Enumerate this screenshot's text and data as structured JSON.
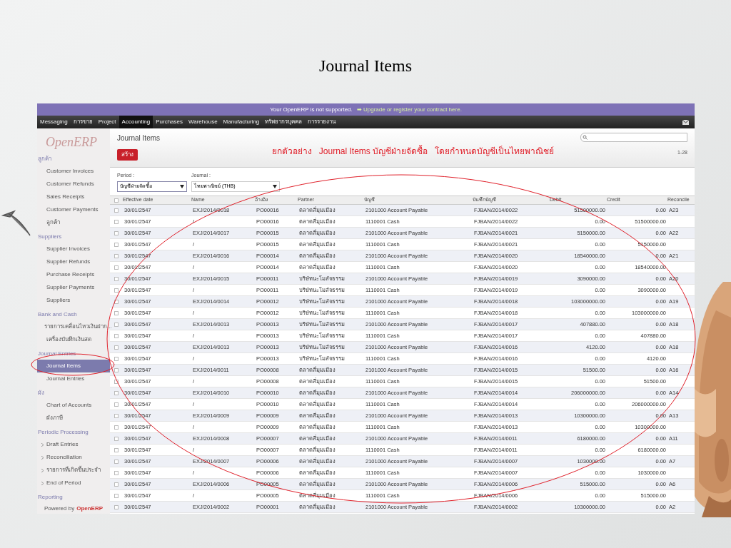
{
  "slide_title": "Journal Items",
  "banner": {
    "text": "Your OpenERP is not supported.",
    "link": "➡ Upgrade or register your contract here."
  },
  "top_menu": [
    {
      "label": "Messaging",
      "selected": false
    },
    {
      "label": "การขาย",
      "selected": false
    },
    {
      "label": "Project",
      "selected": false
    },
    {
      "label": "Accounting",
      "selected": true
    },
    {
      "label": "Purchases",
      "selected": false
    },
    {
      "label": "Warehouse",
      "selected": false
    },
    {
      "label": "Manufacturing",
      "selected": false
    },
    {
      "label": "ทรัพยากรบุคคล",
      "selected": false
    },
    {
      "label": "การรายงาน",
      "selected": false
    }
  ],
  "logo": "OpenERP",
  "sidebar": [
    {
      "heading": "ลูกค้า",
      "items": [
        {
          "label": "Customer Invoices",
          "selected": false,
          "bullet": false
        },
        {
          "label": "Customer Refunds",
          "selected": false,
          "bullet": false
        },
        {
          "label": "Sales Receipts",
          "selected": false,
          "bullet": false
        },
        {
          "label": "Customer Payments",
          "selected": false,
          "bullet": false
        },
        {
          "label": "ลูกค้า",
          "selected": false,
          "bullet": false
        }
      ]
    },
    {
      "heading": "Suppliers",
      "items": [
        {
          "label": "Supplier Invoices",
          "selected": false,
          "bullet": false
        },
        {
          "label": "Supplier Refunds",
          "selected": false,
          "bullet": false
        },
        {
          "label": "Purchase Receipts",
          "selected": false,
          "bullet": false
        },
        {
          "label": "Supplier Payments",
          "selected": false,
          "bullet": false
        },
        {
          "label": "Suppliers",
          "selected": false,
          "bullet": false
        }
      ]
    },
    {
      "heading": "Bank and Cash",
      "items": [
        {
          "label": "รายการเคลื่อนไหวเงินฝาก...",
          "selected": false,
          "bullet": false
        },
        {
          "label": "เครื่องบันทึกเงินสด",
          "selected": false,
          "bullet": false
        }
      ]
    },
    {
      "heading": "Journal Entries",
      "items": [
        {
          "label": "Journal Items",
          "selected": true,
          "bullet": false
        },
        {
          "label": "Journal Entries",
          "selected": false,
          "bullet": false
        }
      ]
    },
    {
      "heading": "ผัง",
      "items": [
        {
          "label": "Chart of Accounts",
          "selected": false,
          "bullet": false
        },
        {
          "label": "ผังภาษี",
          "selected": false,
          "bullet": false
        }
      ]
    },
    {
      "heading": "Periodic Processing",
      "items": [
        {
          "label": "Draft Entries",
          "selected": false,
          "bullet": true
        },
        {
          "label": "Reconciliation",
          "selected": false,
          "bullet": true
        },
        {
          "label": "รายการที่เกิดขึ้นประจำ",
          "selected": false,
          "bullet": true
        },
        {
          "label": "End of Period",
          "selected": false,
          "bullet": true
        }
      ]
    },
    {
      "heading": "Reporting"
    }
  ],
  "footer": {
    "text": "Powered by",
    "brand": "OpenERP"
  },
  "page_title": "Journal Items",
  "create_button": "สร้าง",
  "annotation": "ยกตัวอย่าง   Journal Items บัญชีฝ่ายจัดซื้อ   โดยกำหนดบัญชีเป็นไทยพาณิชย์",
  "pager": "1-28",
  "filters": [
    {
      "label": "Period :",
      "value": "บัญชีฝ่ายจัดซื้อ"
    },
    {
      "label": "Journal :",
      "value": "ไทยพาณิชย์ (THB)"
    }
  ],
  "table": {
    "all_checked": false,
    "columns": [
      "Effective date",
      "Name",
      "อ้างอิง",
      "Partner",
      "บัญชี",
      "บันทึกบัญชี",
      "Debit",
      "Credit",
      "Reconcile"
    ],
    "rows": [
      {
        "checked": false,
        "cells": [
          "30/01/2547",
          "EXJ/2014/0018",
          "PO00016",
          "ตลาดสี่มุมเมือง",
          "2101000 Account Payable",
          "FJBAN/2014/0022",
          "51500000.00",
          "0.00",
          "A23"
        ]
      },
      {
        "checked": false,
        "cells": [
          "30/01/2547",
          "/",
          "PO00016",
          "ตลาดสี่มุมเมือง",
          "1110001 Cash",
          "FJBAN/2014/0022",
          "0.00",
          "51500000.00",
          ""
        ]
      },
      {
        "checked": false,
        "cells": [
          "30/01/2547",
          "EXJ/2014/0017",
          "PO00015",
          "ตลาดสี่มุมเมือง",
          "2101000 Account Payable",
          "FJBAN/2014/0021",
          "5150000.00",
          "0.00",
          "A22"
        ]
      },
      {
        "checked": false,
        "cells": [
          "30/01/2547",
          "/",
          "PO00015",
          "ตลาดสี่มุมเมือง",
          "1110001 Cash",
          "FJBAN/2014/0021",
          "0.00",
          "5150000.00",
          ""
        ]
      },
      {
        "checked": false,
        "cells": [
          "30/01/2547",
          "EXJ/2014/0016",
          "PO00014",
          "ตลาดสี่มุมเมือง",
          "2101000 Account Payable",
          "FJBAN/2014/0020",
          "18540000.00",
          "0.00",
          "A21"
        ]
      },
      {
        "checked": false,
        "cells": [
          "30/01/2547",
          "/",
          "PO00014",
          "ตลาดสี่มุมเมือง",
          "1110001 Cash",
          "FJBAN/2014/0020",
          "0.00",
          "18540000.00",
          ""
        ]
      },
      {
        "checked": false,
        "cells": [
          "30/01/2547",
          "EXJ/2014/0015",
          "PO00011",
          "บริษัทนะโมสัจธรรม",
          "2101000 Account Payable",
          "FJBAN/2014/0019",
          "3090000.00",
          "0.00",
          "A20"
        ]
      },
      {
        "checked": false,
        "cells": [
          "30/01/2547",
          "/",
          "PO00011",
          "บริษัทนะโมสัจธรรม",
          "1110001 Cash",
          "FJBAN/2014/0019",
          "0.00",
          "3090000.00",
          ""
        ]
      },
      {
        "checked": false,
        "cells": [
          "30/01/2547",
          "EXJ/2014/0014",
          "PO00012",
          "บริษัทนะโมสัจธรรม",
          "2101000 Account Payable",
          "FJBAN/2014/0018",
          "103000000.00",
          "0.00",
          "A19"
        ]
      },
      {
        "checked": false,
        "cells": [
          "30/01/2547",
          "/",
          "PO00012",
          "บริษัทนะโมสัจธรรม",
          "1110001 Cash",
          "FJBAN/2014/0018",
          "0.00",
          "103000000.00",
          ""
        ]
      },
      {
        "checked": false,
        "cells": [
          "30/01/2547",
          "EXJ/2014/0013",
          "PO00013",
          "บริษัทนะโมสัจธรรม",
          "2101000 Account Payable",
          "FJBAN/2014/0017",
          "407880.00",
          "0.00",
          "A18"
        ]
      },
      {
        "checked": false,
        "cells": [
          "30/01/2547",
          "/",
          "PO00013",
          "บริษัทนะโมสัจธรรม",
          "1110001 Cash",
          "FJBAN/2014/0017",
          "0.00",
          "407880.00",
          ""
        ]
      },
      {
        "checked": false,
        "cells": [
          "30/01/2547",
          "EXJ/2014/0013",
          "PO00013",
          "บริษัทนะโมสัจธรรม",
          "2101000 Account Payable",
          "FJBAN/2014/0016",
          "4120.00",
          "0.00",
          "A18"
        ]
      },
      {
        "checked": false,
        "cells": [
          "30/01/2547",
          "/",
          "PO00013",
          "บริษัทนะโมสัจธรรม",
          "1110001 Cash",
          "FJBAN/2014/0016",
          "0.00",
          "4120.00",
          ""
        ]
      },
      {
        "checked": false,
        "cells": [
          "30/01/2547",
          "EXJ/2014/0011",
          "PO00008",
          "ตลาดสี่มุมเมือง",
          "2101000 Account Payable",
          "FJBAN/2014/0015",
          "51500.00",
          "0.00",
          "A16"
        ]
      },
      {
        "checked": false,
        "cells": [
          "30/01/2547",
          "/",
          "PO00008",
          "ตลาดสี่มุมเมือง",
          "1110001 Cash",
          "FJBAN/2014/0015",
          "0.00",
          "51500.00",
          ""
        ]
      },
      {
        "checked": false,
        "cells": [
          "30/01/2547",
          "EXJ/2014/0010",
          "PO00010",
          "ตลาดสี่มุมเมือง",
          "2101000 Account Payable",
          "FJBAN/2014/0014",
          "206000000.00",
          "0.00",
          "A14"
        ]
      },
      {
        "checked": false,
        "cells": [
          "30/01/2547",
          "/",
          "PO00010",
          "ตลาดสี่มุมเมือง",
          "1110001 Cash",
          "FJBAN/2014/0014",
          "0.00",
          "206000000.00",
          ""
        ]
      },
      {
        "checked": false,
        "cells": [
          "30/01/2547",
          "EXJ/2014/0009",
          "PO00009",
          "ตลาดสี่มุมเมือง",
          "2101000 Account Payable",
          "FJBAN/2014/0013",
          "10300000.00",
          "0.00",
          "A13"
        ]
      },
      {
        "checked": false,
        "cells": [
          "30/01/2547",
          "/",
          "PO00009",
          "ตลาดสี่มุมเมือง",
          "1110001 Cash",
          "FJBAN/2014/0013",
          "0.00",
          "10300000.00",
          ""
        ]
      },
      {
        "checked": false,
        "cells": [
          "30/01/2547",
          "EXJ/2014/0008",
          "PO00007",
          "ตลาดสี่มุมเมือง",
          "2101000 Account Payable",
          "FJBAN/2014/0011",
          "6180000.00",
          "0.00",
          "A11"
        ]
      },
      {
        "checked": false,
        "cells": [
          "30/01/2547",
          "/",
          "PO00007",
          "ตลาดสี่มุมเมือง",
          "1110001 Cash",
          "FJBAN/2014/0011",
          "0.00",
          "6180000.00",
          ""
        ]
      },
      {
        "checked": false,
        "cells": [
          "30/01/2547",
          "EXJ/2014/0007",
          "PO00006",
          "ตลาดสี่มุมเมือง",
          "2101000 Account Payable",
          "FJBAN/2014/0007",
          "1030000.00",
          "0.00",
          "A7"
        ]
      },
      {
        "checked": false,
        "cells": [
          "30/01/2547",
          "/",
          "PO00006",
          "ตลาดสี่มุมเมือง",
          "1110001 Cash",
          "FJBAN/2014/0007",
          "0.00",
          "1030000.00",
          ""
        ]
      },
      {
        "checked": false,
        "cells": [
          "30/01/2547",
          "EXJ/2014/0006",
          "PO00005",
          "ตลาดสี่มุมเมือง",
          "2101000 Account Payable",
          "FJBAN/2014/0006",
          "515000.00",
          "0.00",
          "A6"
        ]
      },
      {
        "checked": false,
        "cells": [
          "30/01/2547",
          "/",
          "PO00005",
          "ตลาดสี่มุมเมือง",
          "1110001 Cash",
          "FJBAN/2014/0006",
          "0.00",
          "515000.00",
          ""
        ]
      },
      {
        "checked": false,
        "cells": [
          "30/01/2547",
          "EXJ/2014/0002",
          "PO00001",
          "ตลาดสี่มุมเมือง",
          "2101000 Account Payable",
          "FJBAN/2014/0002",
          "10300000.00",
          "0.00",
          "A2"
        ]
      }
    ]
  }
}
